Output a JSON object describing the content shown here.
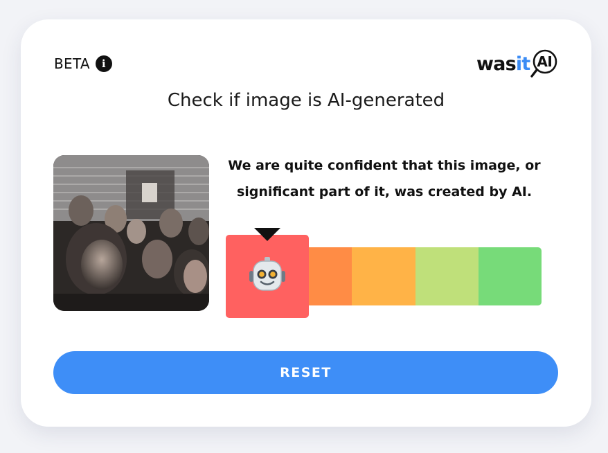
{
  "header": {
    "badge_label": "BETA",
    "info_icon": "info-icon"
  },
  "logo": {
    "part1": "was",
    "part2": "it",
    "badge": "AI",
    "icon": "magnifier-icon"
  },
  "title": "Check if image is AI-generated",
  "result": {
    "line1": "We are quite confident that this image, or",
    "line2": "significant part of it, was created by AI.",
    "meter": {
      "level": 1,
      "level_count": 5,
      "segment_colors": [
        "#ff6160",
        "#ff8c45",
        "#ffb347",
        "#bfe07a",
        "#77db79"
      ],
      "active_icon": "robot-icon"
    }
  },
  "reset_label": "RESET",
  "colors": {
    "accent": "#3e8ef7",
    "logo_it": "#3b8cf5"
  }
}
